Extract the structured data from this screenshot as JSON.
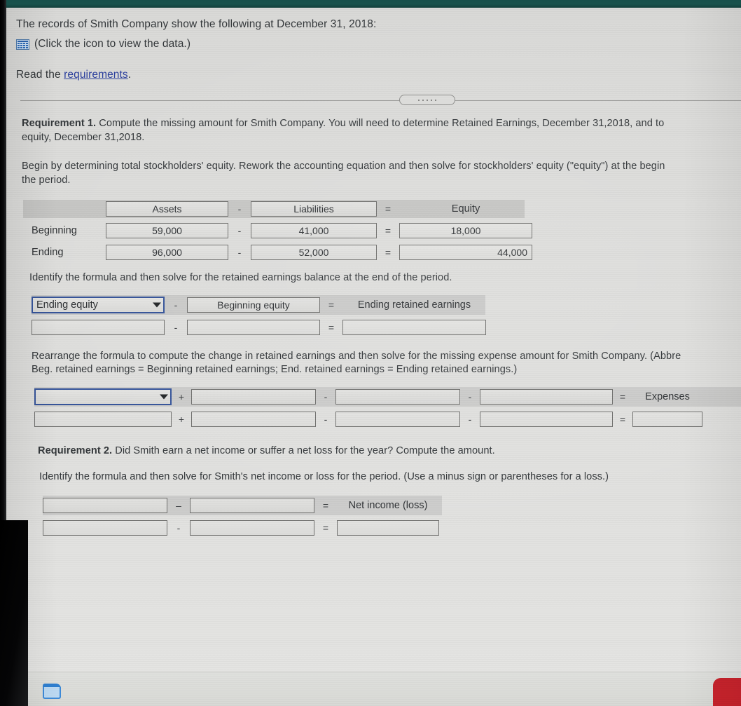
{
  "intro": {
    "statement": "The records of Smith Company show the following at December 31, 2018:",
    "icon_label": "(Click the icon to view the data.)",
    "icon_name": "spreadsheet-icon",
    "read_prefix": "Read the ",
    "read_link": "requirements",
    "read_suffix": "."
  },
  "divider": {
    "handle_dots": 5
  },
  "requirement1": {
    "heading_bold": "Requirement 1.",
    "heading_rest": " Compute the missing amount for Smith Company. You will need to determine Retained Earnings, December 31,2018, and to",
    "heading_line2": "equity, December 31,2018.",
    "instruction_line1": "Begin by determining total stockholders' equity. Rework the accounting equation and then solve for stockholders' equity (\"equity\") at the begin",
    "instruction_line2": "the period."
  },
  "equity_table": {
    "headers": {
      "assets": "Assets",
      "liabilities": "Liabilities",
      "equity": "Equity"
    },
    "operators": {
      "minus": "-",
      "equals": "="
    },
    "rows": [
      {
        "label": "Beginning",
        "assets": "59,000",
        "liabilities": "41,000",
        "equity": "18,000",
        "equity_align": "center"
      },
      {
        "label": "Ending",
        "assets": "96,000",
        "liabilities": "52,000",
        "equity": "44,000",
        "equity_align": "right"
      }
    ]
  },
  "retained_earnings": {
    "prompt": "Identify the formula and then solve for the retained earnings balance at the end of the period.",
    "formula_row": {
      "term1": "Ending equity",
      "op1": "-",
      "term2": "Beginning equity",
      "op2": "=",
      "result": "Ending retained earnings"
    },
    "value_row": {
      "term1": "",
      "op1": "-",
      "term2": "",
      "op2": "=",
      "result": ""
    }
  },
  "expenses": {
    "prompt_line1": "Rearrange the formula to compute the change in retained earnings and then solve for the missing expense amount for Smith Company. (Abbre",
    "prompt_line2": "Beg. retained earnings = Beginning retained earnings; End. retained earnings = Ending retained earnings.)",
    "formula_row": {
      "term1": "",
      "op1": "+",
      "term2": "",
      "op2": "-",
      "term3": "",
      "op3": "-",
      "term4": "",
      "op4": "=",
      "result": "Expenses"
    },
    "value_row": {
      "term1": "",
      "op1": "+",
      "term2": "",
      "op2": "-",
      "term3": "",
      "op3": "-",
      "term4": "",
      "op4": "=",
      "result": ""
    }
  },
  "requirement2": {
    "heading_bold": "Requirement 2.",
    "heading_rest": " Did Smith earn a net income or suffer a net loss for the year? Compute the amount.",
    "prompt": "Identify the formula and then solve for Smith's net income or loss for the period. (Use a minus sign or parentheses for a loss.)",
    "formula_row": {
      "term1": "",
      "op1": "–",
      "term2": "",
      "op2": "=",
      "result": "Net income (loss)"
    },
    "value_row": {
      "term1": "",
      "op1": "-",
      "term2": "",
      "op2": "=",
      "result": ""
    }
  },
  "taskbar": {
    "explorer_icon": "file-explorer-icon",
    "accent_icon": "red-app-icon"
  },
  "colors": {
    "top_bar": "#17504b",
    "link": "#2b3f9e",
    "focus_border": "#35549a",
    "icon_blue": "#2f6dbb",
    "taskbar_red": "#c8232c",
    "screen_bg": "#dedeDc"
  }
}
